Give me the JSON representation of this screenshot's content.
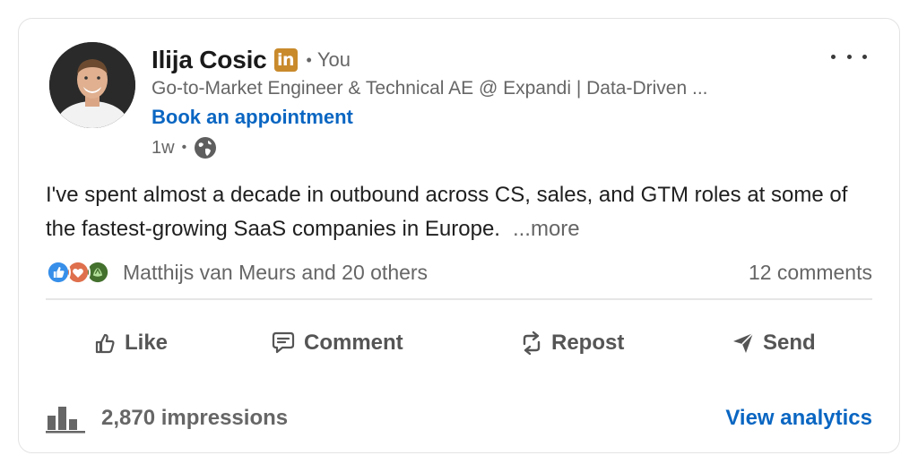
{
  "author": {
    "name": "Ilija Cosic",
    "badge": "in",
    "relation": "You",
    "headline": "Go-to-Market Engineer & Technical AE @ Expandi | Data-Driven ...",
    "cta": "Book an appointment",
    "age": "1w",
    "visibility_icon": "globe-icon"
  },
  "post": {
    "text": "I've spent almost a decade in outbound across CS, sales, and GTM roles at some of the fastest-growing SaaS companies in Europe.",
    "more_label": "...more"
  },
  "social": {
    "reaction_icons": [
      "like-reaction-icon",
      "love-reaction-icon",
      "celebrate-reaction-icon"
    ],
    "reactors_label": "Matthijs van Meurs and 20 others",
    "comments_label": "12 comments"
  },
  "actions": {
    "like": "Like",
    "comment": "Comment",
    "repost": "Repost",
    "send": "Send"
  },
  "analytics": {
    "impressions": "2,870 impressions",
    "view_label": "View analytics"
  },
  "colors": {
    "link_blue": "#0a66c2",
    "badge_gold": "#c98a2c",
    "muted_text": "#666666"
  }
}
